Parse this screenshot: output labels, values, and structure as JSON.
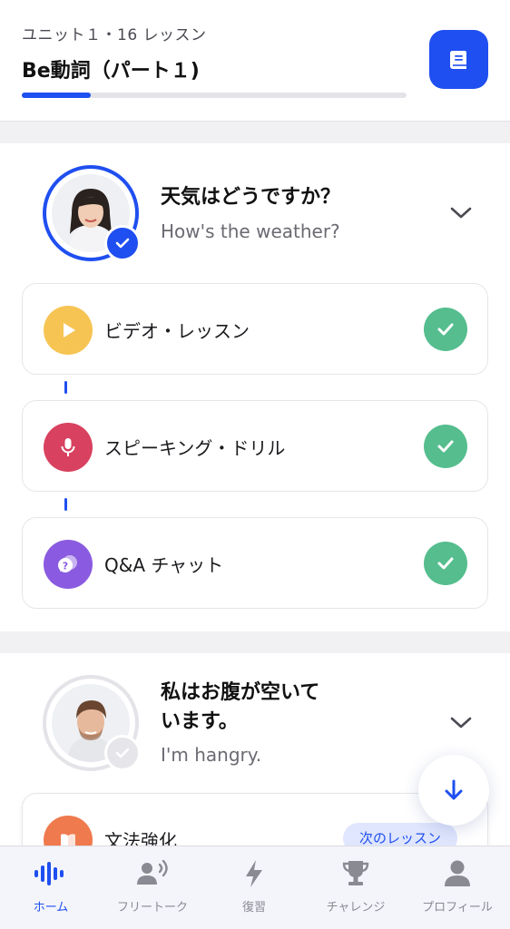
{
  "header": {
    "unit_info": "ユニット１・16 レッスン",
    "title": "Be動詞（パート１)",
    "progress_fraction": 0.18,
    "book_icon": "book-icon"
  },
  "lessons": [
    {
      "title": "天気はどうですか？",
      "subtitle": "How's the weather?",
      "completed": true,
      "steps": [
        {
          "label": "ビデオ・レッスン",
          "icon": "play-icon",
          "icon_color": "#f6c453",
          "done": true
        },
        {
          "label": "スピーキング・ドリル",
          "icon": "microphone-icon",
          "icon_color": "#d8415f",
          "done": true
        },
        {
          "label": "Q&A チャット",
          "icon": "chat-question-icon",
          "icon_color": "#8a5be0",
          "done": true
        }
      ]
    },
    {
      "title_line1": "私はお腹が空いて",
      "title_line2": "います。",
      "subtitle": "I'm hangry.",
      "completed": false,
      "next_step": {
        "label": "文法強化",
        "icon": "grammar-book-icon",
        "icon_color": "#ef7a4d",
        "badge": "次のレッスン"
      }
    }
  ],
  "tabs": [
    {
      "label": "ホーム",
      "icon": "home-waveform-icon",
      "active": true
    },
    {
      "label": "フリートーク",
      "icon": "speaking-person-icon",
      "active": false
    },
    {
      "label": "復習",
      "icon": "lightning-icon",
      "active": false
    },
    {
      "label": "チャレンジ",
      "icon": "trophy-icon",
      "active": false
    },
    {
      "label": "プロフィール",
      "icon": "person-icon",
      "active": false
    }
  ],
  "colors": {
    "accent": "#1f4ff0",
    "success": "#55bd8e",
    "background": "#f1f1f3"
  }
}
